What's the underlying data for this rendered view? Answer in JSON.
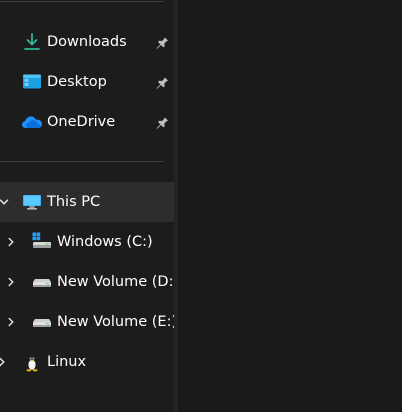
{
  "quick_access": {
    "items": [
      {
        "label": "Downloads",
        "icon": "download-icon",
        "pinned": true
      },
      {
        "label": "Desktop",
        "icon": "desktop-folder-icon",
        "pinned": true
      },
      {
        "label": "OneDrive",
        "icon": "onedrive-cloud-icon",
        "pinned": true
      }
    ]
  },
  "tree": {
    "this_pc": {
      "label": "This PC",
      "icon": "monitor-icon",
      "expanded": true,
      "selected": true
    },
    "drives": [
      {
        "label": "Windows (C:)",
        "icon": "windows-drive-icon"
      },
      {
        "label": "New Volume (D:)",
        "icon": "drive-icon"
      },
      {
        "label": "New Volume (E:)",
        "icon": "drive-icon"
      }
    ],
    "linux": {
      "label": "Linux",
      "icon": "linux-penguin-icon"
    }
  },
  "colors": {
    "background": "#191919",
    "nav_background": "#1c1c1c",
    "selected_row": "#2d2d2d",
    "text": "#ffffff",
    "download_accent": "#2fb59a",
    "desktop_accent": "#1a9fe0",
    "onedrive_accent": "#1e90ff",
    "monitor_accent": "#3ab4f2"
  }
}
